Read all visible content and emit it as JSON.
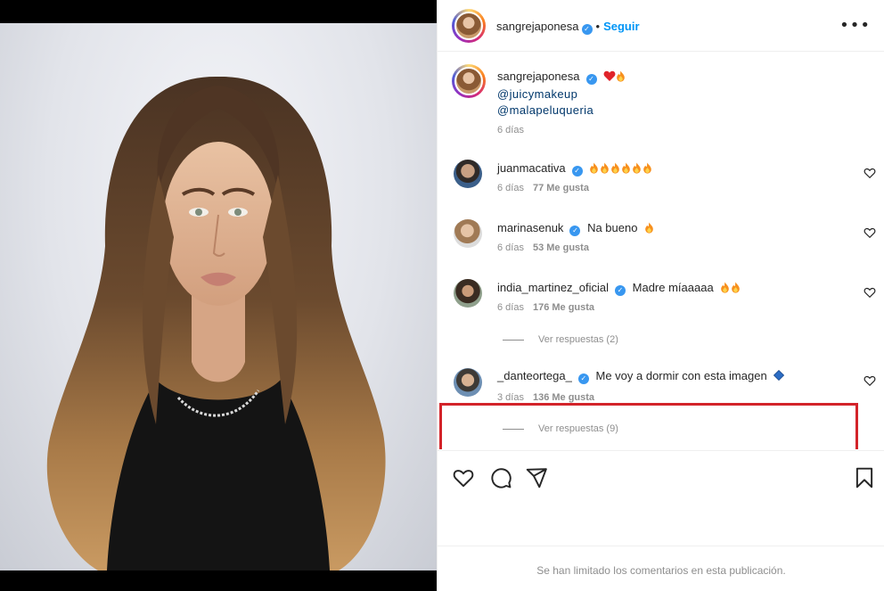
{
  "post": {
    "author": "sangrejaponesa",
    "verified_glyph": "✓",
    "separator": "•",
    "follow_label": "Seguir",
    "more_label": "•••",
    "caption": {
      "username": "sangrejaponesa",
      "mentions": [
        "@juicymakeup",
        "@malapeluqueria"
      ],
      "age": "6 días"
    }
  },
  "comments": [
    {
      "username": "juanmacativa",
      "text": "",
      "fire_count": 6,
      "age": "6 días",
      "likes": "77 Me gusta"
    },
    {
      "username": "marinasenuk",
      "text": "Na bueno",
      "fire_count": 1,
      "age": "6 días",
      "likes": "53 Me gusta"
    },
    {
      "username": "india_martinez_oficial",
      "text": "Madre míaaaaa",
      "fire_count": 2,
      "age": "6 días",
      "likes": "176 Me gusta",
      "replies": "Ver respuestas (2)"
    },
    {
      "username": "_danteortega_",
      "text": "Me voy a dormir con esta imagen",
      "age": "3 días",
      "likes": "136 Me gusta",
      "replies": "Ver respuestas (9)",
      "highlighted": true
    }
  ],
  "actions": {
    "icons": [
      "heart-icon",
      "comment-icon",
      "share-icon",
      "bookmark-icon"
    ]
  },
  "footer": {
    "notice": "Se han limitado los comentarios en esta publicación."
  },
  "colors": {
    "follow": "#0095f6",
    "verified": "#3897f0",
    "highlight_border": "#d3232a",
    "mention": "#00376b",
    "muted": "#8e8e8e"
  }
}
